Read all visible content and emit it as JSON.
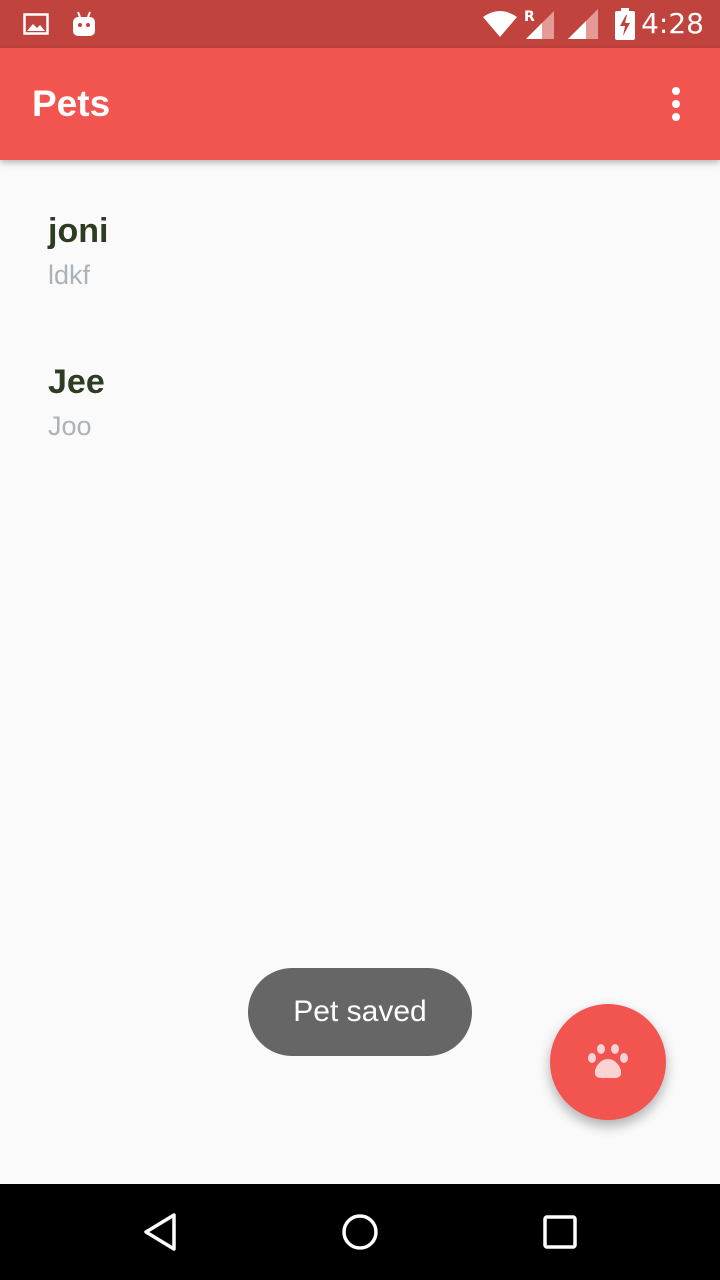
{
  "status_bar": {
    "time": "4:28",
    "icons": [
      "image-notification-icon",
      "android-notification-icon",
      "wifi-icon",
      "signal-roaming-icon",
      "signal-icon",
      "battery-charging-icon"
    ],
    "roaming_label": "R"
  },
  "app_bar": {
    "title": "Pets",
    "overflow_icon": "more-vert-icon"
  },
  "pets": [
    {
      "name": "joni",
      "breed": "ldkf"
    },
    {
      "name": "Jee",
      "breed": "Joo"
    }
  ],
  "toast": {
    "message": "Pet saved"
  },
  "fab": {
    "icon": "paw-icon"
  },
  "nav_bar": {
    "icons": [
      "back-icon",
      "home-icon",
      "recents-icon"
    ]
  },
  "colors": {
    "primary": "#f2544f",
    "primary_dark": "#c0433d",
    "pet_name": "#2e3c22",
    "pet_breed": "#aab2ba",
    "toast_bg": "#666666"
  }
}
